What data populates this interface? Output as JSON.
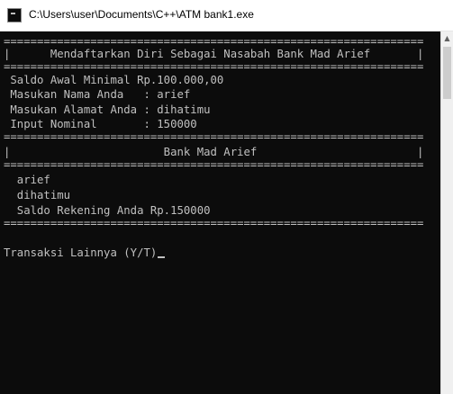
{
  "window": {
    "title": "C:\\Users\\user\\Documents\\C++\\ATM bank1.exe",
    "icon": "console-app-icon"
  },
  "console": {
    "lines": [
      "===============================================================",
      "|      Mendaftarkan Diri Sebagai Nasabah Bank Mad Arief       |",
      "===============================================================",
      " Saldo Awal Minimal Rp.100.000,00",
      " Masukan Nama Anda   : arief",
      " Masukan Alamat Anda : dihatimu",
      " Input Nominal       : 150000",
      "===============================================================",
      "|                       Bank Mad Arief                        |",
      "===============================================================",
      "  arief",
      "  dihatimu",
      "  Saldo Rekening Anda Rp.150000",
      "===============================================================",
      "",
      "Transaksi Lainnya (Y/T)"
    ]
  },
  "colors": {
    "console_bg": "#0c0c0c",
    "console_fg": "#c0c0c0"
  }
}
